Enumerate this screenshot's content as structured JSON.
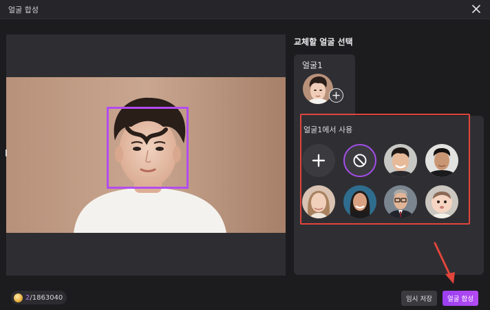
{
  "window": {
    "title": "얼굴 합성"
  },
  "sidebar": {
    "title": "교체할 얼굴 선택",
    "face_card": {
      "label": "얼굴1"
    },
    "panel": {
      "label": "얼굴1에서 사용",
      "options": [
        {
          "kind": "add",
          "icon": "plus-icon"
        },
        {
          "kind": "none",
          "icon": "ban-icon",
          "selected": true
        },
        {
          "kind": "face",
          "description": "young man smiling"
        },
        {
          "kind": "face",
          "description": "young man dark shirt"
        },
        {
          "kind": "face",
          "description": "woman with long hair"
        },
        {
          "kind": "face",
          "description": "woman smiling"
        },
        {
          "kind": "face",
          "description": "man with glasses in suit"
        },
        {
          "kind": "face",
          "description": "baby"
        }
      ]
    }
  },
  "footer": {
    "credits_used": "2",
    "credits_total": "/1863040",
    "save_label": "임시 저장",
    "compose_label": "얼굴 합성"
  },
  "colors": {
    "accent": "#b34cf0",
    "highlight": "#e2453c",
    "background": "#1c1c1f",
    "panel": "#2f2f33"
  }
}
